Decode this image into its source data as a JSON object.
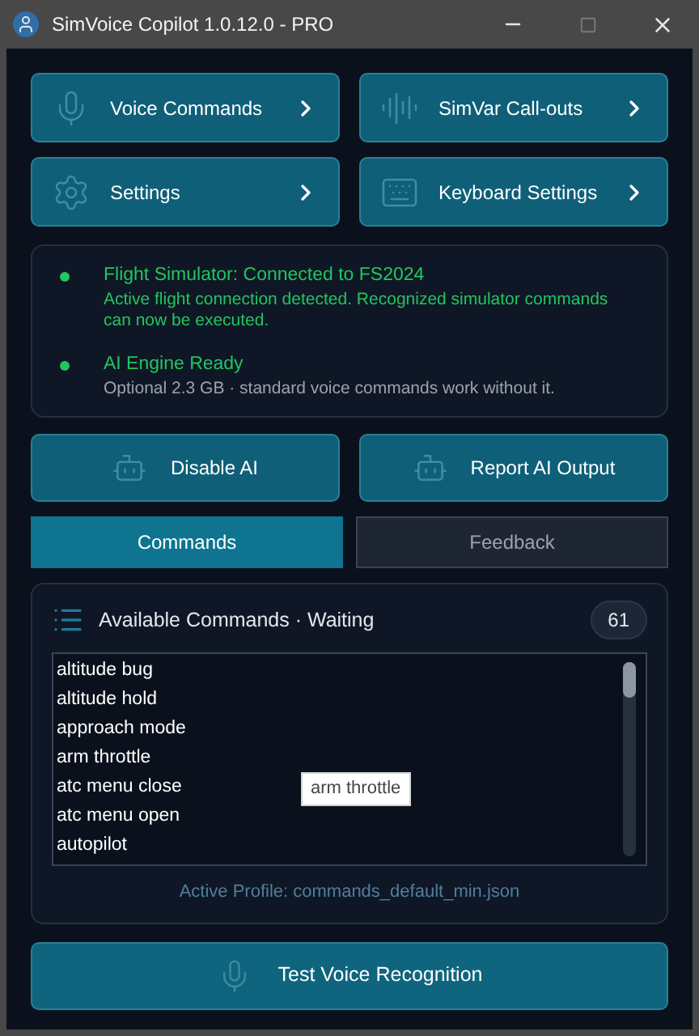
{
  "window": {
    "title": "SimVoice Copilot 1.0.12.0 - PRO",
    "maximize_disabled": true
  },
  "nav_buttons": [
    {
      "label": "Voice Commands",
      "kind": "mic"
    },
    {
      "label": "SimVar Call-outs",
      "kind": "wave"
    },
    {
      "label": "Settings",
      "kind": "gear"
    },
    {
      "label": "Keyboard Settings",
      "kind": "keyboard"
    }
  ],
  "status": [
    {
      "title": "Flight Simulator: Connected to FS2024",
      "description": "Active flight connection detected. Recognized simulator commands can now be executed.",
      "color": "#22c55e",
      "kind": "connected"
    },
    {
      "title": "AI Engine Ready",
      "description": "Optional 2.3 GB · standard voice commands work without it.",
      "color": "#22c55e",
      "kind": "info"
    }
  ],
  "ai_buttons": [
    "Disable AI",
    "Report AI Output"
  ],
  "tabs": [
    {
      "label": "Commands",
      "selected": true
    },
    {
      "label": "Feedback",
      "selected": false
    }
  ],
  "commands": {
    "title": "Available Commands · Waiting",
    "count": "61",
    "items": [
      "altitude bug",
      "altitude hold",
      "approach mode",
      "arm throttle",
      "atc menu close",
      "atc menu open",
      "autopilot"
    ],
    "tooltip": "arm throttle",
    "footer": "Active Profile: commands_default_min.json"
  },
  "test_button": "Test Voice Recognition"
}
